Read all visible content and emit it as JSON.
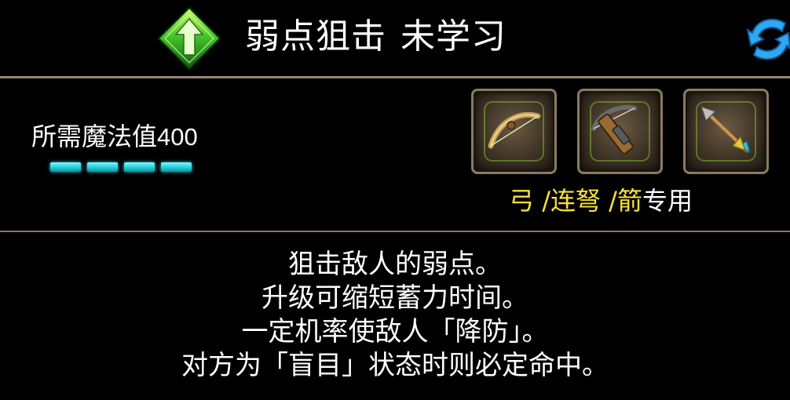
{
  "header": {
    "skill_name": "弱点狙击",
    "status": "未学习",
    "icons": {
      "level": "green-up-arrow-icon",
      "refresh": "blue-refresh-icon"
    }
  },
  "cost": {
    "label": "所需魔法值",
    "value": "400",
    "bar_segments": 4,
    "bar_color": "#2fd9e6"
  },
  "weapons": {
    "slots": [
      {
        "name": "弓",
        "icon": "bow-icon"
      },
      {
        "name": "连弩",
        "icon": "crossbow-icon"
      },
      {
        "name": "箭",
        "icon": "arrow-icon"
      }
    ],
    "note": {
      "w1": "弓",
      "sep1": " /",
      "w2": "连弩",
      "sep2": " /",
      "w3": "箭",
      "suffix": "专用"
    },
    "highlight_color": "#f7e13a"
  },
  "description": {
    "lines": [
      "狙击敌人的弱点。",
      "升级可缩短蓄力时间。",
      "一定机率使敌人「降防」。",
      "对方为「盲目」状态时则必定命中。"
    ]
  }
}
